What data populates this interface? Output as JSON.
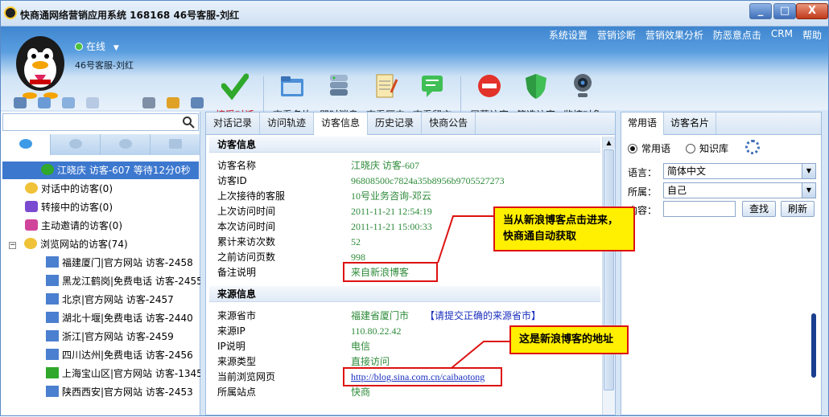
{
  "title": "快商通网络营销应用系统  168168  46号客服-刘红",
  "window_buttons": {
    "minimize": "_",
    "maximize": "□",
    "close": "X"
  },
  "menu": [
    "系统设置",
    "营销诊断",
    "营销效果分析",
    "防恶意点击",
    "CRM",
    "帮助"
  ],
  "profile": {
    "status": "在线",
    "name": "46号客服-刘红"
  },
  "toolbar": [
    {
      "label": "接受对话",
      "icon": "check-icon"
    },
    {
      "label": "查看名片",
      "icon": "folder-icon"
    },
    {
      "label": "即时消息",
      "icon": "server-icon"
    },
    {
      "label": "查看历史",
      "icon": "notepad-icon"
    },
    {
      "label": "查看留言",
      "icon": "message-icon"
    },
    {
      "label": "屏蔽访客",
      "icon": "stop-icon"
    },
    {
      "label": "筛选访客",
      "icon": "shield-icon"
    },
    {
      "label": "监控对象",
      "icon": "webcam-icon"
    }
  ],
  "tree": {
    "selected": "江晓庆  访客-607  等待12分0秒",
    "groups": [
      "对话中的访客(0)",
      "转接中的访客(0)",
      "主动邀请的访客(0)",
      "浏览网站的访客(74)"
    ],
    "visitors": [
      "福建厦门|官方网站  访客-2458",
      "黑龙江鹤岗|免费电话  访客-2455",
      "北京|官方网站  访客-2457",
      "湖北十堰|免费电话  访客-2440",
      "浙江|官方网站  访客-2459",
      "四川达州|免费电话  访客-2456",
      "上海宝山区|官方网站  访客-1345",
      "陕西西安|官方网站  访客-2453"
    ]
  },
  "tabs": [
    "对话记录",
    "访问轨迹",
    "访客信息",
    "历史记录",
    "快商公告"
  ],
  "visitor_info": {
    "section": "访客信息",
    "fields": [
      {
        "k": "访客名称",
        "v": "江晓庆  访客-607"
      },
      {
        "k": "访客ID",
        "v": "96808500c7824a35b8956b9705527273"
      },
      {
        "k": "上次接待的客服",
        "v": "10号业务咨询-邓云"
      },
      {
        "k": "上次访问时间",
        "v": "2011-11-21 12:54:19"
      },
      {
        "k": "本次访问时间",
        "v": "2011-11-21 15:00:33"
      },
      {
        "k": "累计来访次数",
        "v": "52"
      },
      {
        "k": "之前访问页数",
        "v": "998"
      },
      {
        "k": "备注说明",
        "v": "来自新浪博客"
      }
    ]
  },
  "source_info": {
    "section": "来源信息",
    "fields": [
      {
        "k": "来源省市",
        "v": "福建省厦门市"
      },
      {
        "k": "来源IP",
        "v": "110.80.22.42"
      },
      {
        "k": "IP说明",
        "v": "电信"
      },
      {
        "k": "来源类型",
        "v": "直接访问"
      },
      {
        "k": "当前浏览网页",
        "v": "http://blog.sina.com.cn/caibaotong"
      },
      {
        "k": "所属站点",
        "v": "快商"
      }
    ],
    "report_link": "【请提交正确的来源省市】"
  },
  "right": {
    "tabs": [
      "常用语",
      "访客名片"
    ],
    "radio": [
      "常用语",
      "知识库"
    ],
    "lang_label": "语言：",
    "lang_value": "简体中文",
    "owner_label": "所属：",
    "owner_value": "自己",
    "content_label": "内容：",
    "search_btn": "查找",
    "refresh_btn": "刷新"
  },
  "callouts": [
    "当从新浪博客点击进来，快商通自动获取",
    "这是新浪博客的地址"
  ],
  "colors": {
    "accent": "#3d78cf",
    "value_green": "#2e8b3a",
    "link_blue": "#1a2fbf",
    "callout_bg": "#ffef00",
    "callout_border": "#d11"
  }
}
